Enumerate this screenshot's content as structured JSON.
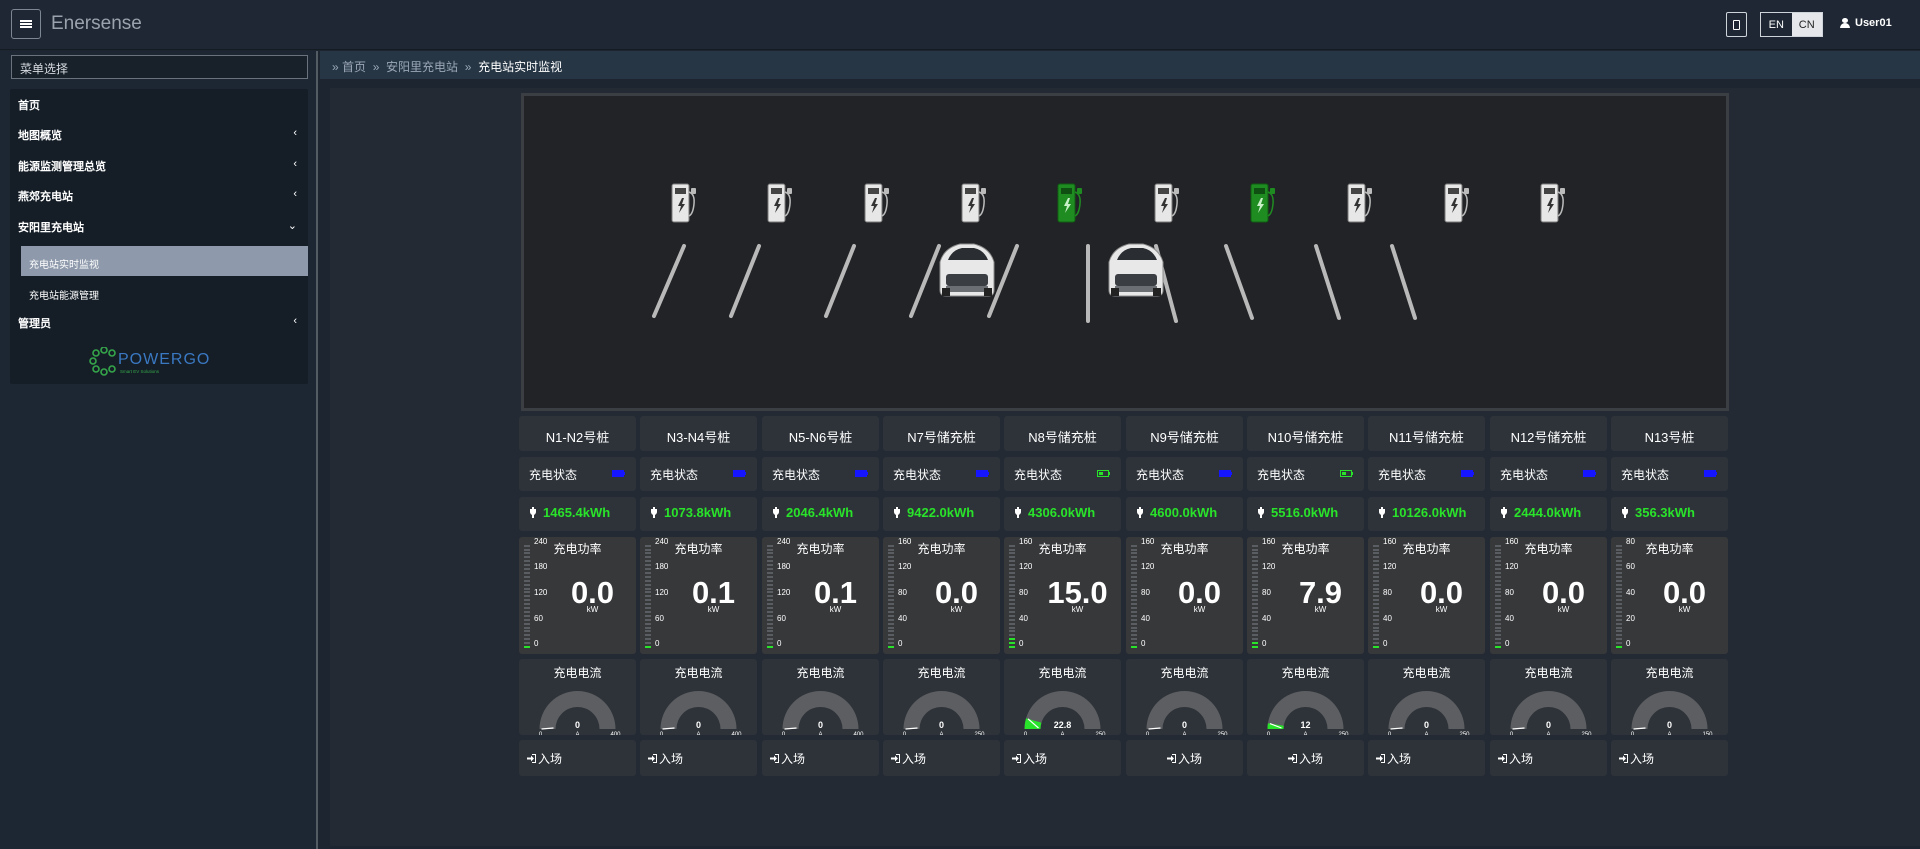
{
  "app": {
    "brand": "Enersense",
    "lang_en": "EN",
    "lang_cn": "CN",
    "user": "User01"
  },
  "sidebar": {
    "menu_title": "菜单选择",
    "items": [
      {
        "label": "首页",
        "chevron": ""
      },
      {
        "label": "地图概览",
        "chevron": "‹"
      },
      {
        "label": "能源监测管理总览",
        "chevron": "‹"
      },
      {
        "label": "燕郊充电站",
        "chevron": "‹"
      },
      {
        "label": "安阳里充电站",
        "chevron": "⌄"
      },
      {
        "label": "充电站实时监视",
        "chevron": ""
      },
      {
        "label": "充电站能源管理",
        "chevron": ""
      },
      {
        "label": "管理员",
        "chevron": "‹"
      }
    ],
    "logo_text": "POWERGO",
    "logo_sub": "Smart EV Solutions"
  },
  "breadcrumb": {
    "home": "首页",
    "station": "安阳里充电站",
    "current": "充电站实时监视"
  },
  "colors": {
    "ok": "#29e32a",
    "idle_bar": "#1515ff",
    "charging": "#1f8c22",
    "bg": "#232a33"
  },
  "lot": {
    "charger_states": [
      "idle",
      "idle",
      "idle",
      "idle",
      "charging",
      "idle",
      "charging",
      "idle",
      "idle",
      "idle"
    ]
  },
  "common": {
    "status_label": "充电状态",
    "power_label": "充电功率",
    "power_unit": "kW",
    "current_label": "充电电流",
    "current_unit": "A",
    "entry_label": "入场"
  },
  "piles": [
    {
      "name": "N1-N2号桩",
      "status": "idle",
      "energy": "1465.4kWh",
      "power": "0.0",
      "power_max": "240",
      "ticks": [
        "240",
        "180",
        "120",
        "60",
        "0"
      ],
      "current": "0",
      "current_value": 0,
      "current_min": "0",
      "current_max": "400"
    },
    {
      "name": "N3-N4号桩",
      "status": "idle",
      "energy": "1073.8kWh",
      "power": "0.1",
      "power_max": "240",
      "ticks": [
        "240",
        "180",
        "120",
        "60",
        "0"
      ],
      "current": "0",
      "current_value": 0,
      "current_min": "0",
      "current_max": "400"
    },
    {
      "name": "N5-N6号桩",
      "status": "idle",
      "energy": "2046.4kWh",
      "power": "0.1",
      "power_max": "240",
      "ticks": [
        "240",
        "180",
        "120",
        "60",
        "0"
      ],
      "current": "0",
      "current_value": 0,
      "current_min": "0",
      "current_max": "400"
    },
    {
      "name": "N7号储充桩",
      "status": "idle",
      "energy": "9422.0kWh",
      "power": "0.0",
      "power_max": "160",
      "ticks": [
        "160",
        "120",
        "80",
        "40",
        "0"
      ],
      "current": "0",
      "current_value": 0,
      "current_min": "0",
      "current_max": "250"
    },
    {
      "name": "N8号储充桩",
      "status": "charging",
      "energy": "4306.0kWh",
      "power": "15.0",
      "power_max": "160",
      "ticks": [
        "160",
        "120",
        "80",
        "40",
        "0"
      ],
      "current": "22.8",
      "current_value": 22.8,
      "current_min": "0",
      "current_max": "250"
    },
    {
      "name": "N9号储充桩",
      "status": "idle",
      "energy": "4600.0kWh",
      "power": "0.0",
      "power_max": "160",
      "ticks": [
        "160",
        "120",
        "80",
        "40",
        "0"
      ],
      "current": "0",
      "current_value": 0,
      "current_min": "0",
      "current_max": "250"
    },
    {
      "name": "N10号储充桩",
      "status": "charging",
      "energy": "5516.0kWh",
      "power": "7.9",
      "power_max": "160",
      "ticks": [
        "160",
        "120",
        "80",
        "40",
        "0"
      ],
      "current": "12",
      "current_value": 12,
      "current_min": "0",
      "current_max": "250"
    },
    {
      "name": "N11号储充桩",
      "status": "idle",
      "energy": "10126.0kWh",
      "power": "0.0",
      "power_max": "160",
      "ticks": [
        "160",
        "120",
        "80",
        "40",
        "0"
      ],
      "current": "0",
      "current_value": 0,
      "current_min": "0",
      "current_max": "250"
    },
    {
      "name": "N12号储充桩",
      "status": "idle",
      "energy": "2444.0kWh",
      "power": "0.0",
      "power_max": "160",
      "ticks": [
        "160",
        "120",
        "80",
        "40",
        "0"
      ],
      "current": "0",
      "current_value": 0,
      "current_min": "0",
      "current_max": "250"
    },
    {
      "name": "N13号桩",
      "status": "idle",
      "energy": "356.3kWh",
      "power": "0.0",
      "power_max": "80",
      "ticks": [
        "80",
        "60",
        "40",
        "20",
        "0"
      ],
      "current": "0",
      "current_value": 0,
      "current_min": "0",
      "current_max": "150"
    }
  ]
}
